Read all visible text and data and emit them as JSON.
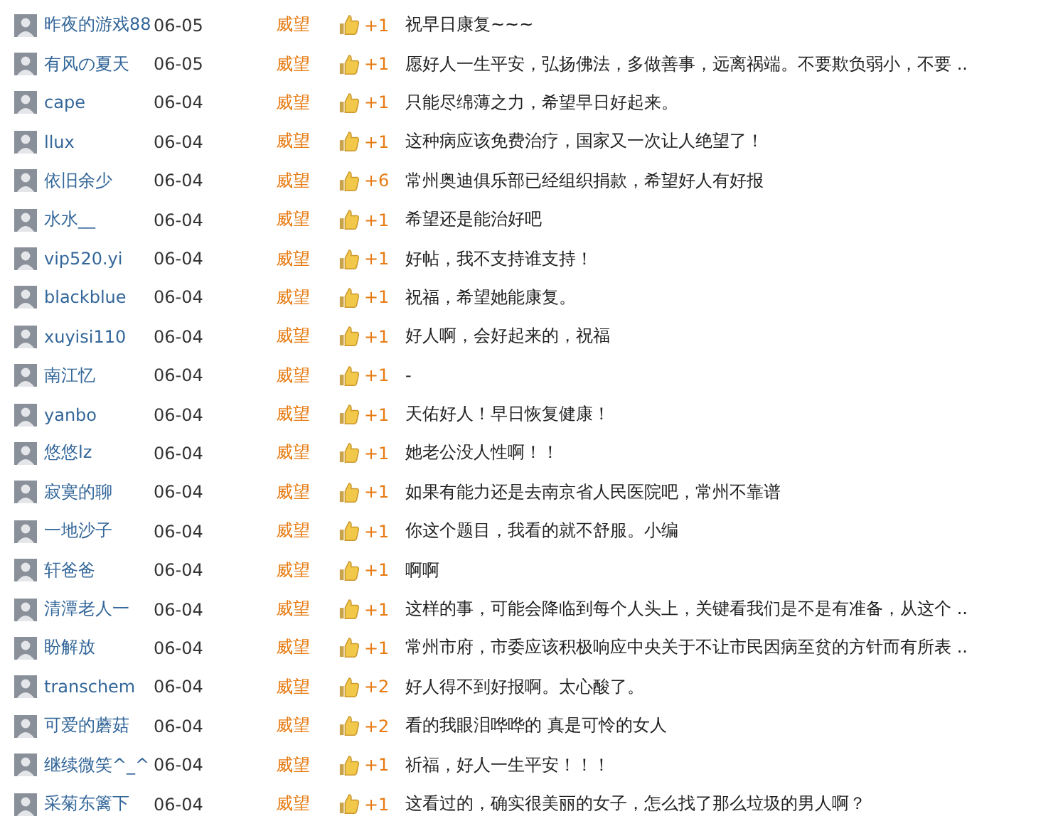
{
  "rows": [
    {
      "user": "昨夜的游戏88",
      "date": "06-05",
      "type": "威望",
      "score": "+1",
      "comment": "祝早日康复~~~"
    },
    {
      "user": "有风の夏天",
      "date": "06-05",
      "type": "威望",
      "score": "+1",
      "comment": "愿好人一生平安，弘扬佛法，多做善事，远离祸端。不要欺负弱小，不要 .."
    },
    {
      "user": "cape",
      "date": "06-04",
      "type": "威望",
      "score": "+1",
      "comment": "只能尽绵薄之力，希望早日好起来。"
    },
    {
      "user": "llux",
      "date": "06-04",
      "type": "威望",
      "score": "+1",
      "comment": "这种病应该免费治疗，国家又一次让人绝望了！"
    },
    {
      "user": "依旧余少",
      "date": "06-04",
      "type": "威望",
      "score": "+6",
      "comment": "常州奥迪俱乐部已经组织捐款，希望好人有好报"
    },
    {
      "user": "水水__",
      "date": "06-04",
      "type": "威望",
      "score": "+1",
      "comment": "希望还是能治好吧"
    },
    {
      "user": "vip520.yi",
      "date": "06-04",
      "type": "威望",
      "score": "+1",
      "comment": "好帖，我不支持谁支持！"
    },
    {
      "user": "blackblue",
      "date": "06-04",
      "type": "威望",
      "score": "+1",
      "comment": "祝福，希望她能康复。"
    },
    {
      "user": "xuyisi110",
      "date": "06-04",
      "type": "威望",
      "score": "+1",
      "comment": "好人啊，会好起来的，祝福"
    },
    {
      "user": "南江忆",
      "date": "06-04",
      "type": "威望",
      "score": "+1",
      "comment": "-"
    },
    {
      "user": "yanbo",
      "date": "06-04",
      "type": "威望",
      "score": "+1",
      "comment": "天佑好人！早日恢复健康！"
    },
    {
      "user": "悠悠lz",
      "date": "06-04",
      "type": "威望",
      "score": "+1",
      "comment": "她老公没人性啊！！"
    },
    {
      "user": "寂寞的聊",
      "date": "06-04",
      "type": "威望",
      "score": "+1",
      "comment": "如果有能力还是去南京省人民医院吧，常州不靠谱"
    },
    {
      "user": "一地沙子",
      "date": "06-04",
      "type": "威望",
      "score": "+1",
      "comment": "你这个题目，我看的就不舒服。小编"
    },
    {
      "user": "轩爸爸",
      "date": "06-04",
      "type": "威望",
      "score": "+1",
      "comment": "啊啊"
    },
    {
      "user": "清潭老人一",
      "date": "06-04",
      "type": "威望",
      "score": "+1",
      "comment": "这样的事，可能会降临到每个人头上，关键看我们是不是有准备，从这个 .."
    },
    {
      "user": "盼解放",
      "date": "06-04",
      "type": "威望",
      "score": "+1",
      "comment": "常州市府，市委应该积极响应中央关于不让市民因病至贫的方针而有所表 .."
    },
    {
      "user": "transchem",
      "date": "06-04",
      "type": "威望",
      "score": "+2",
      "comment": "好人得不到好报啊。太心酸了。"
    },
    {
      "user": "可爱的蘑菇",
      "date": "06-04",
      "type": "威望",
      "score": "+2",
      "comment": "看的我眼泪哗哗的 真是可怜的女人"
    },
    {
      "user": "继续微笑^_^",
      "date": "06-04",
      "type": "威望",
      "score": "+1",
      "comment": "祈福，好人一生平安！！！"
    },
    {
      "user": "采菊东篱下",
      "date": "06-04",
      "type": "威望",
      "score": "+1",
      "comment": "这看过的，确实很美丽的女子，怎么找了那么垃圾的男人啊？"
    }
  ]
}
